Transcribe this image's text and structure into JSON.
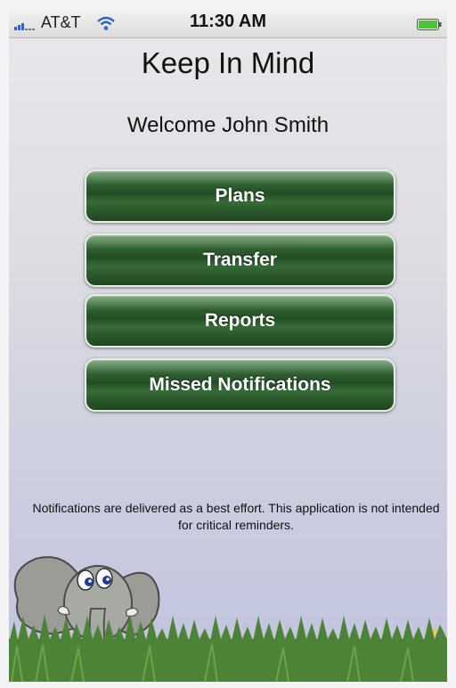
{
  "status_bar": {
    "carrier": "AT&T",
    "time": "11:30 AM",
    "icons": [
      "signal-bars-icon",
      "wifi-icon",
      "battery-icon"
    ]
  },
  "app": {
    "title": "Keep In Mind",
    "welcome": "Welcome John Smith"
  },
  "menu": {
    "plans_label": "Plans",
    "transfer_label": "Transfer",
    "reports_label": "Reports",
    "missed_label": "Missed Notifications"
  },
  "notice": "Notifications are delivered as a best effort. This application is not intended for critical reminders.",
  "colors": {
    "button_green": "#2f5f30",
    "button_text": "#ffffff",
    "background": "#dedde3",
    "grass": "#3c6a2a"
  }
}
